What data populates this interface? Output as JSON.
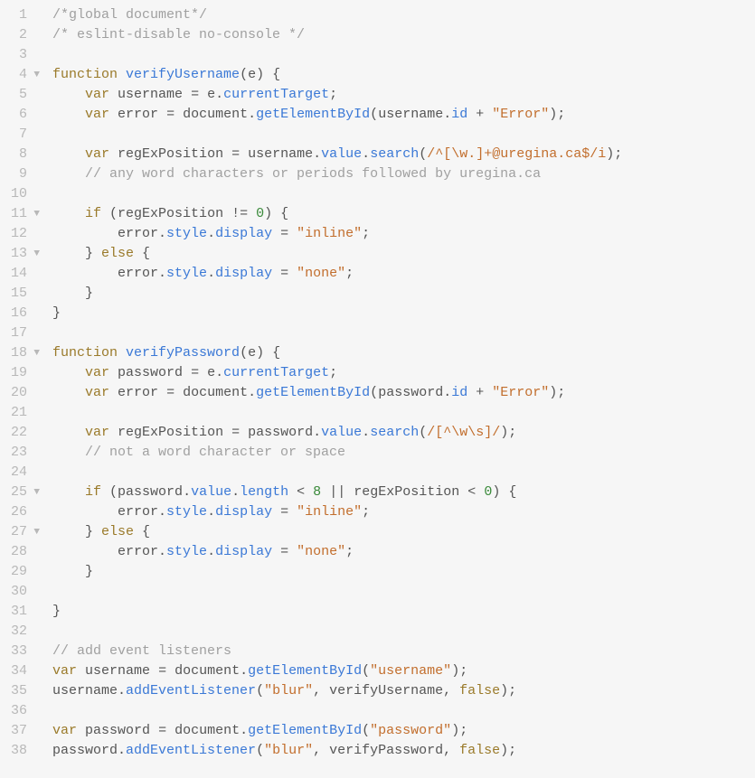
{
  "gutter": {
    "fold_glyph": "▼",
    "rows": [
      {
        "n": "1",
        "fold": false
      },
      {
        "n": "2",
        "fold": false
      },
      {
        "n": "3",
        "fold": false
      },
      {
        "n": "4",
        "fold": true
      },
      {
        "n": "5",
        "fold": false
      },
      {
        "n": "6",
        "fold": false
      },
      {
        "n": "7",
        "fold": false
      },
      {
        "n": "8",
        "fold": false
      },
      {
        "n": "9",
        "fold": false
      },
      {
        "n": "10",
        "fold": false
      },
      {
        "n": "11",
        "fold": true
      },
      {
        "n": "12",
        "fold": false
      },
      {
        "n": "13",
        "fold": true
      },
      {
        "n": "14",
        "fold": false
      },
      {
        "n": "15",
        "fold": false
      },
      {
        "n": "16",
        "fold": false
      },
      {
        "n": "17",
        "fold": false
      },
      {
        "n": "18",
        "fold": true
      },
      {
        "n": "19",
        "fold": false
      },
      {
        "n": "20",
        "fold": false
      },
      {
        "n": "21",
        "fold": false
      },
      {
        "n": "22",
        "fold": false
      },
      {
        "n": "23",
        "fold": false
      },
      {
        "n": "24",
        "fold": false
      },
      {
        "n": "25",
        "fold": true
      },
      {
        "n": "26",
        "fold": false
      },
      {
        "n": "27",
        "fold": true
      },
      {
        "n": "28",
        "fold": false
      },
      {
        "n": "29",
        "fold": false
      },
      {
        "n": "30",
        "fold": false
      },
      {
        "n": "31",
        "fold": false
      },
      {
        "n": "32",
        "fold": false
      },
      {
        "n": "33",
        "fold": false
      },
      {
        "n": "34",
        "fold": false
      },
      {
        "n": "35",
        "fold": false
      },
      {
        "n": "36",
        "fold": false
      },
      {
        "n": "37",
        "fold": false
      },
      {
        "n": "38",
        "fold": false
      }
    ]
  },
  "code": {
    "lines": [
      [
        {
          "c": "comment",
          "t": "/*global document*/"
        }
      ],
      [
        {
          "c": "comment",
          "t": "/* eslint-disable no-console */"
        }
      ],
      [],
      [
        {
          "c": "keyword",
          "t": "function"
        },
        {
          "c": "punct",
          "t": " "
        },
        {
          "c": "deffunc",
          "t": "verifyUsername"
        },
        {
          "c": "punct",
          "t": "("
        },
        {
          "c": "ident",
          "t": "e"
        },
        {
          "c": "punct",
          "t": ") {"
        }
      ],
      [
        {
          "c": "punct",
          "t": "    "
        },
        {
          "c": "keyword",
          "t": "var"
        },
        {
          "c": "punct",
          "t": " "
        },
        {
          "c": "ident",
          "t": "username"
        },
        {
          "c": "punct",
          "t": " "
        },
        {
          "c": "operator",
          "t": "="
        },
        {
          "c": "punct",
          "t": " "
        },
        {
          "c": "ident",
          "t": "e"
        },
        {
          "c": "punct",
          "t": "."
        },
        {
          "c": "prop",
          "t": "currentTarget"
        },
        {
          "c": "punct",
          "t": ";"
        }
      ],
      [
        {
          "c": "punct",
          "t": "    "
        },
        {
          "c": "keyword",
          "t": "var"
        },
        {
          "c": "punct",
          "t": " "
        },
        {
          "c": "ident",
          "t": "error"
        },
        {
          "c": "punct",
          "t": " "
        },
        {
          "c": "operator",
          "t": "="
        },
        {
          "c": "punct",
          "t": " "
        },
        {
          "c": "ident",
          "t": "document"
        },
        {
          "c": "punct",
          "t": "."
        },
        {
          "c": "prop",
          "t": "getElementById"
        },
        {
          "c": "punct",
          "t": "("
        },
        {
          "c": "ident",
          "t": "username"
        },
        {
          "c": "punct",
          "t": "."
        },
        {
          "c": "prop",
          "t": "id"
        },
        {
          "c": "punct",
          "t": " "
        },
        {
          "c": "operator",
          "t": "+"
        },
        {
          "c": "punct",
          "t": " "
        },
        {
          "c": "string",
          "t": "\"Error\""
        },
        {
          "c": "punct",
          "t": ");"
        }
      ],
      [],
      [
        {
          "c": "punct",
          "t": "    "
        },
        {
          "c": "keyword",
          "t": "var"
        },
        {
          "c": "punct",
          "t": " "
        },
        {
          "c": "ident",
          "t": "regExPosition"
        },
        {
          "c": "punct",
          "t": " "
        },
        {
          "c": "operator",
          "t": "="
        },
        {
          "c": "punct",
          "t": " "
        },
        {
          "c": "ident",
          "t": "username"
        },
        {
          "c": "punct",
          "t": "."
        },
        {
          "c": "prop",
          "t": "value"
        },
        {
          "c": "punct",
          "t": "."
        },
        {
          "c": "prop",
          "t": "search"
        },
        {
          "c": "punct",
          "t": "("
        },
        {
          "c": "regex",
          "t": "/^[\\w.]+@uregina.ca$/i"
        },
        {
          "c": "punct",
          "t": ");"
        }
      ],
      [
        {
          "c": "punct",
          "t": "    "
        },
        {
          "c": "comment",
          "t": "// any word characters or periods followed by uregina.ca"
        }
      ],
      [],
      [
        {
          "c": "punct",
          "t": "    "
        },
        {
          "c": "keyword",
          "t": "if"
        },
        {
          "c": "punct",
          "t": " ("
        },
        {
          "c": "ident",
          "t": "regExPosition"
        },
        {
          "c": "punct",
          "t": " "
        },
        {
          "c": "operator",
          "t": "!="
        },
        {
          "c": "punct",
          "t": " "
        },
        {
          "c": "number",
          "t": "0"
        },
        {
          "c": "punct",
          "t": ") {"
        }
      ],
      [
        {
          "c": "punct",
          "t": "        "
        },
        {
          "c": "ident",
          "t": "error"
        },
        {
          "c": "punct",
          "t": "."
        },
        {
          "c": "prop",
          "t": "style"
        },
        {
          "c": "punct",
          "t": "."
        },
        {
          "c": "prop",
          "t": "display"
        },
        {
          "c": "punct",
          "t": " "
        },
        {
          "c": "operator",
          "t": "="
        },
        {
          "c": "punct",
          "t": " "
        },
        {
          "c": "string",
          "t": "\"inline\""
        },
        {
          "c": "punct",
          "t": ";"
        }
      ],
      [
        {
          "c": "punct",
          "t": "    } "
        },
        {
          "c": "keyword",
          "t": "else"
        },
        {
          "c": "punct",
          "t": " {"
        }
      ],
      [
        {
          "c": "punct",
          "t": "        "
        },
        {
          "c": "ident",
          "t": "error"
        },
        {
          "c": "punct",
          "t": "."
        },
        {
          "c": "prop",
          "t": "style"
        },
        {
          "c": "punct",
          "t": "."
        },
        {
          "c": "prop",
          "t": "display"
        },
        {
          "c": "punct",
          "t": " "
        },
        {
          "c": "operator",
          "t": "="
        },
        {
          "c": "punct",
          "t": " "
        },
        {
          "c": "string",
          "t": "\"none\""
        },
        {
          "c": "punct",
          "t": ";"
        }
      ],
      [
        {
          "c": "punct",
          "t": "    }"
        }
      ],
      [
        {
          "c": "punct",
          "t": "}"
        }
      ],
      [],
      [
        {
          "c": "keyword",
          "t": "function"
        },
        {
          "c": "punct",
          "t": " "
        },
        {
          "c": "deffunc",
          "t": "verifyPassword"
        },
        {
          "c": "punct",
          "t": "("
        },
        {
          "c": "ident",
          "t": "e"
        },
        {
          "c": "punct",
          "t": ") {"
        }
      ],
      [
        {
          "c": "punct",
          "t": "    "
        },
        {
          "c": "keyword",
          "t": "var"
        },
        {
          "c": "punct",
          "t": " "
        },
        {
          "c": "ident",
          "t": "password"
        },
        {
          "c": "punct",
          "t": " "
        },
        {
          "c": "operator",
          "t": "="
        },
        {
          "c": "punct",
          "t": " "
        },
        {
          "c": "ident",
          "t": "e"
        },
        {
          "c": "punct",
          "t": "."
        },
        {
          "c": "prop",
          "t": "currentTarget"
        },
        {
          "c": "punct",
          "t": ";"
        }
      ],
      [
        {
          "c": "punct",
          "t": "    "
        },
        {
          "c": "keyword",
          "t": "var"
        },
        {
          "c": "punct",
          "t": " "
        },
        {
          "c": "ident",
          "t": "error"
        },
        {
          "c": "punct",
          "t": " "
        },
        {
          "c": "operator",
          "t": "="
        },
        {
          "c": "punct",
          "t": " "
        },
        {
          "c": "ident",
          "t": "document"
        },
        {
          "c": "punct",
          "t": "."
        },
        {
          "c": "prop",
          "t": "getElementById"
        },
        {
          "c": "punct",
          "t": "("
        },
        {
          "c": "ident",
          "t": "password"
        },
        {
          "c": "punct",
          "t": "."
        },
        {
          "c": "prop",
          "t": "id"
        },
        {
          "c": "punct",
          "t": " "
        },
        {
          "c": "operator",
          "t": "+"
        },
        {
          "c": "punct",
          "t": " "
        },
        {
          "c": "string",
          "t": "\"Error\""
        },
        {
          "c": "punct",
          "t": ");"
        }
      ],
      [],
      [
        {
          "c": "punct",
          "t": "    "
        },
        {
          "c": "keyword",
          "t": "var"
        },
        {
          "c": "punct",
          "t": " "
        },
        {
          "c": "ident",
          "t": "regExPosition"
        },
        {
          "c": "punct",
          "t": " "
        },
        {
          "c": "operator",
          "t": "="
        },
        {
          "c": "punct",
          "t": " "
        },
        {
          "c": "ident",
          "t": "password"
        },
        {
          "c": "punct",
          "t": "."
        },
        {
          "c": "prop",
          "t": "value"
        },
        {
          "c": "punct",
          "t": "."
        },
        {
          "c": "prop",
          "t": "search"
        },
        {
          "c": "punct",
          "t": "("
        },
        {
          "c": "regex",
          "t": "/[^\\w\\s]/"
        },
        {
          "c": "punct",
          "t": ");"
        }
      ],
      [
        {
          "c": "punct",
          "t": "    "
        },
        {
          "c": "comment",
          "t": "// not a word character or space"
        }
      ],
      [],
      [
        {
          "c": "punct",
          "t": "    "
        },
        {
          "c": "keyword",
          "t": "if"
        },
        {
          "c": "punct",
          "t": " ("
        },
        {
          "c": "ident",
          "t": "password"
        },
        {
          "c": "punct",
          "t": "."
        },
        {
          "c": "prop",
          "t": "value"
        },
        {
          "c": "punct",
          "t": "."
        },
        {
          "c": "prop",
          "t": "length"
        },
        {
          "c": "punct",
          "t": " "
        },
        {
          "c": "operator",
          "t": "<"
        },
        {
          "c": "punct",
          "t": " "
        },
        {
          "c": "number",
          "t": "8"
        },
        {
          "c": "punct",
          "t": " "
        },
        {
          "c": "operator",
          "t": "||"
        },
        {
          "c": "punct",
          "t": " "
        },
        {
          "c": "ident",
          "t": "regExPosition"
        },
        {
          "c": "punct",
          "t": " "
        },
        {
          "c": "operator",
          "t": "<"
        },
        {
          "c": "punct",
          "t": " "
        },
        {
          "c": "number",
          "t": "0"
        },
        {
          "c": "punct",
          "t": ") {"
        }
      ],
      [
        {
          "c": "punct",
          "t": "        "
        },
        {
          "c": "ident",
          "t": "error"
        },
        {
          "c": "punct",
          "t": "."
        },
        {
          "c": "prop",
          "t": "style"
        },
        {
          "c": "punct",
          "t": "."
        },
        {
          "c": "prop",
          "t": "display"
        },
        {
          "c": "punct",
          "t": " "
        },
        {
          "c": "operator",
          "t": "="
        },
        {
          "c": "punct",
          "t": " "
        },
        {
          "c": "string",
          "t": "\"inline\""
        },
        {
          "c": "punct",
          "t": ";"
        }
      ],
      [
        {
          "c": "punct",
          "t": "    } "
        },
        {
          "c": "keyword",
          "t": "else"
        },
        {
          "c": "punct",
          "t": " {"
        }
      ],
      [
        {
          "c": "punct",
          "t": "        "
        },
        {
          "c": "ident",
          "t": "error"
        },
        {
          "c": "punct",
          "t": "."
        },
        {
          "c": "prop",
          "t": "style"
        },
        {
          "c": "punct",
          "t": "."
        },
        {
          "c": "prop",
          "t": "display"
        },
        {
          "c": "punct",
          "t": " "
        },
        {
          "c": "operator",
          "t": "="
        },
        {
          "c": "punct",
          "t": " "
        },
        {
          "c": "string",
          "t": "\"none\""
        },
        {
          "c": "punct",
          "t": ";"
        }
      ],
      [
        {
          "c": "punct",
          "t": "    }"
        }
      ],
      [],
      [
        {
          "c": "punct",
          "t": "}"
        }
      ],
      [],
      [
        {
          "c": "comment",
          "t": "// add event listeners"
        }
      ],
      [
        {
          "c": "keyword",
          "t": "var"
        },
        {
          "c": "punct",
          "t": " "
        },
        {
          "c": "ident",
          "t": "username"
        },
        {
          "c": "punct",
          "t": " "
        },
        {
          "c": "operator",
          "t": "="
        },
        {
          "c": "punct",
          "t": " "
        },
        {
          "c": "ident",
          "t": "document"
        },
        {
          "c": "punct",
          "t": "."
        },
        {
          "c": "prop",
          "t": "getElementById"
        },
        {
          "c": "punct",
          "t": "("
        },
        {
          "c": "string",
          "t": "\"username\""
        },
        {
          "c": "punct",
          "t": ");"
        }
      ],
      [
        {
          "c": "ident",
          "t": "username"
        },
        {
          "c": "punct",
          "t": "."
        },
        {
          "c": "prop",
          "t": "addEventListener"
        },
        {
          "c": "punct",
          "t": "("
        },
        {
          "c": "string",
          "t": "\"blur\""
        },
        {
          "c": "punct",
          "t": ", "
        },
        {
          "c": "ident",
          "t": "verifyUsername"
        },
        {
          "c": "punct",
          "t": ", "
        },
        {
          "c": "bool",
          "t": "false"
        },
        {
          "c": "punct",
          "t": ");"
        }
      ],
      [],
      [
        {
          "c": "keyword",
          "t": "var"
        },
        {
          "c": "punct",
          "t": " "
        },
        {
          "c": "ident",
          "t": "password"
        },
        {
          "c": "punct",
          "t": " "
        },
        {
          "c": "operator",
          "t": "="
        },
        {
          "c": "punct",
          "t": " "
        },
        {
          "c": "ident",
          "t": "document"
        },
        {
          "c": "punct",
          "t": "."
        },
        {
          "c": "prop",
          "t": "getElementById"
        },
        {
          "c": "punct",
          "t": "("
        },
        {
          "c": "string",
          "t": "\"password\""
        },
        {
          "c": "punct",
          "t": ");"
        }
      ],
      [
        {
          "c": "ident",
          "t": "password"
        },
        {
          "c": "punct",
          "t": "."
        },
        {
          "c": "prop",
          "t": "addEventListener"
        },
        {
          "c": "punct",
          "t": "("
        },
        {
          "c": "string",
          "t": "\"blur\""
        },
        {
          "c": "punct",
          "t": ", "
        },
        {
          "c": "ident",
          "t": "verifyPassword"
        },
        {
          "c": "punct",
          "t": ", "
        },
        {
          "c": "bool",
          "t": "false"
        },
        {
          "c": "punct",
          "t": ");"
        }
      ]
    ]
  }
}
